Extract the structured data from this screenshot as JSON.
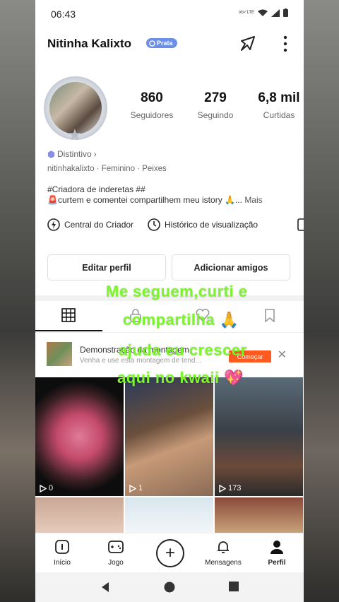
{
  "status_bar": {
    "time": "06:43",
    "network_label": "Vo¹⁄ LTE"
  },
  "profile": {
    "name": "Nitinha Kalixto",
    "badge": "Prata",
    "stats": [
      {
        "value": "860",
        "label": "Seguidores"
      },
      {
        "value": "279",
        "label": "Seguindo"
      },
      {
        "value": "6,8 mil",
        "label": "Curtidas"
      }
    ],
    "distintivo": "Distintivo",
    "meta": "nitinhakalixto · Feminino · Peixes",
    "bio_line1": "#Criadora de inderetas ##",
    "bio_line2": "🚨curtem e comentei compartilhem meu istory 🙏...",
    "bio_more": "Mais"
  },
  "tools": {
    "creator_center": "Central do Criador",
    "history": "Histórico de visualização"
  },
  "buttons": {
    "edit_profile": "Editar perfil",
    "add_friends": "Adicionar amigos"
  },
  "promo": {
    "title": "Demonstração da montagem",
    "subtitle": "Venha e use esta montagem de tend...",
    "cta": "Começar"
  },
  "overlay_text": [
    "Me  seguem,curti e",
    "compartilha 🙏",
    "ajuda eu crescer",
    "aqui no kwaii 💖"
  ],
  "grid": [
    {
      "views": "0"
    },
    {
      "views": "1"
    },
    {
      "views": "173"
    }
  ],
  "bottom_nav": [
    {
      "label": "Início"
    },
    {
      "label": "Jogo"
    },
    {
      "label": "Mensagens"
    },
    {
      "label": "Perfil"
    }
  ],
  "colors": {
    "accent_orange": "#ff5a1f",
    "badge_blue": "#6d8fe6",
    "overlay_green": "#7cf52c"
  }
}
